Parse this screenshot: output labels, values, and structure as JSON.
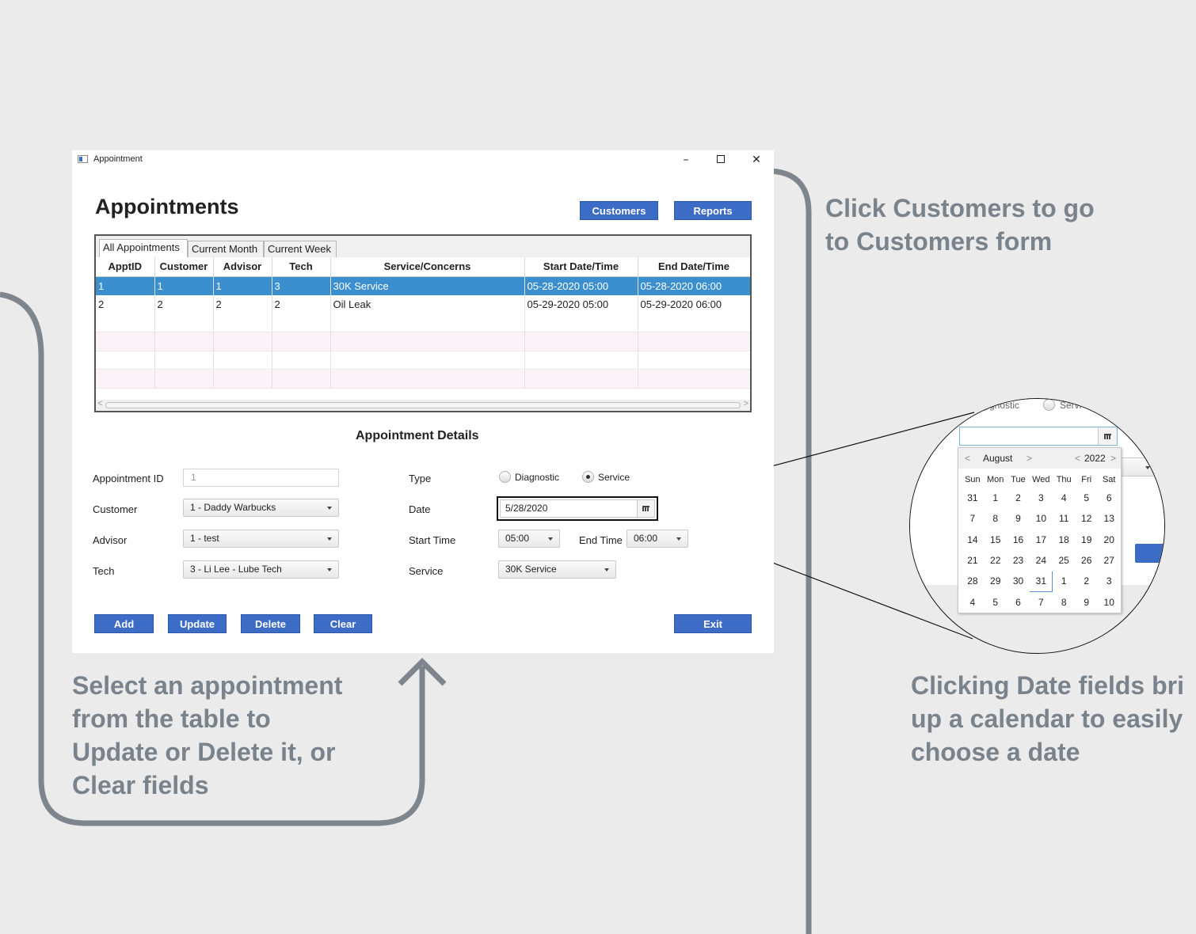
{
  "window": {
    "title": "Appointment",
    "controls": {
      "minimize": "–",
      "close": "✕"
    }
  },
  "header": {
    "title": "Appointments",
    "customers_label": "Customers",
    "reports_label": "Reports"
  },
  "tabs": [
    "All Appointments",
    "Current Month",
    "Current Week"
  ],
  "table": {
    "columns": [
      "ApptID",
      "Customer",
      "Advisor",
      "Tech",
      "Service/Concerns",
      "Start Date/Time",
      "End Date/Time"
    ],
    "rows": [
      [
        "1",
        "1",
        "1",
        "3",
        "30K Service",
        "05-28-2020 05:00",
        "05-28-2020 06:00"
      ],
      [
        "2",
        "2",
        "2",
        "2",
        "Oil Leak",
        "05-29-2020 05:00",
        "05-29-2020 06:00"
      ]
    ],
    "selected_row": 0,
    "scroll_arrows": {
      "left": "<",
      "right": ">"
    }
  },
  "details": {
    "title": "Appointment Details",
    "appointment_id": {
      "label": "Appointment ID",
      "value": "1"
    },
    "customer": {
      "label": "Customer",
      "value": "1 - Daddy Warbucks"
    },
    "advisor": {
      "label": "Advisor",
      "value": "1 - test"
    },
    "tech": {
      "label": "Tech",
      "value": "3 - Li Lee - Lube Tech"
    },
    "type": {
      "label": "Type",
      "options": [
        "Diagnostic",
        "Service"
      ],
      "selected": "Service"
    },
    "date": {
      "label": "Date",
      "value": "5/28/2020"
    },
    "start_time": {
      "label": "Start Time",
      "value": "05:00"
    },
    "end_time": {
      "label": "End Time",
      "value": "06:00"
    },
    "service": {
      "label": "Service",
      "value": "30K Service"
    }
  },
  "actions": {
    "add": "Add",
    "update": "Update",
    "delete": "Delete",
    "clear": "Clear",
    "exit": "Exit"
  },
  "callouts": {
    "customers": [
      "Click Customers to go",
      "to Customers form"
    ],
    "select": [
      "Select an appointment",
      "from the table to",
      "Update or Delete  it, or",
      "Clear fields"
    ],
    "calendar": [
      "Clicking Date fields bri",
      "up a calendar to easily",
      "choose a date"
    ]
  },
  "calendar_popup": {
    "partial_radio_labels": [
      "gnostic",
      "Servi"
    ],
    "month": "August",
    "year": "2022",
    "prev": "<",
    "next": ">",
    "weekdays": [
      "Sun",
      "Mon",
      "Tue",
      "Wed",
      "Thu",
      "Fri",
      "Sat"
    ],
    "weeks": [
      [
        "31",
        "1",
        "2",
        "3",
        "4",
        "5",
        "6"
      ],
      [
        "7",
        "8",
        "9",
        "10",
        "11",
        "12",
        "13"
      ],
      [
        "14",
        "15",
        "16",
        "17",
        "18",
        "19",
        "20"
      ],
      [
        "21",
        "22",
        "23",
        "24",
        "25",
        "26",
        "27"
      ],
      [
        "28",
        "29",
        "30",
        "31",
        "1",
        "2",
        "3"
      ],
      [
        "4",
        "5",
        "6",
        "7",
        "8",
        "9",
        "10"
      ]
    ],
    "highlighted_day": "31"
  },
  "colors": {
    "accent_button": "#3c6cc5",
    "selected_row": "#3b8fcf",
    "callout_text": "#7a838c",
    "connector": "#7e858d"
  }
}
